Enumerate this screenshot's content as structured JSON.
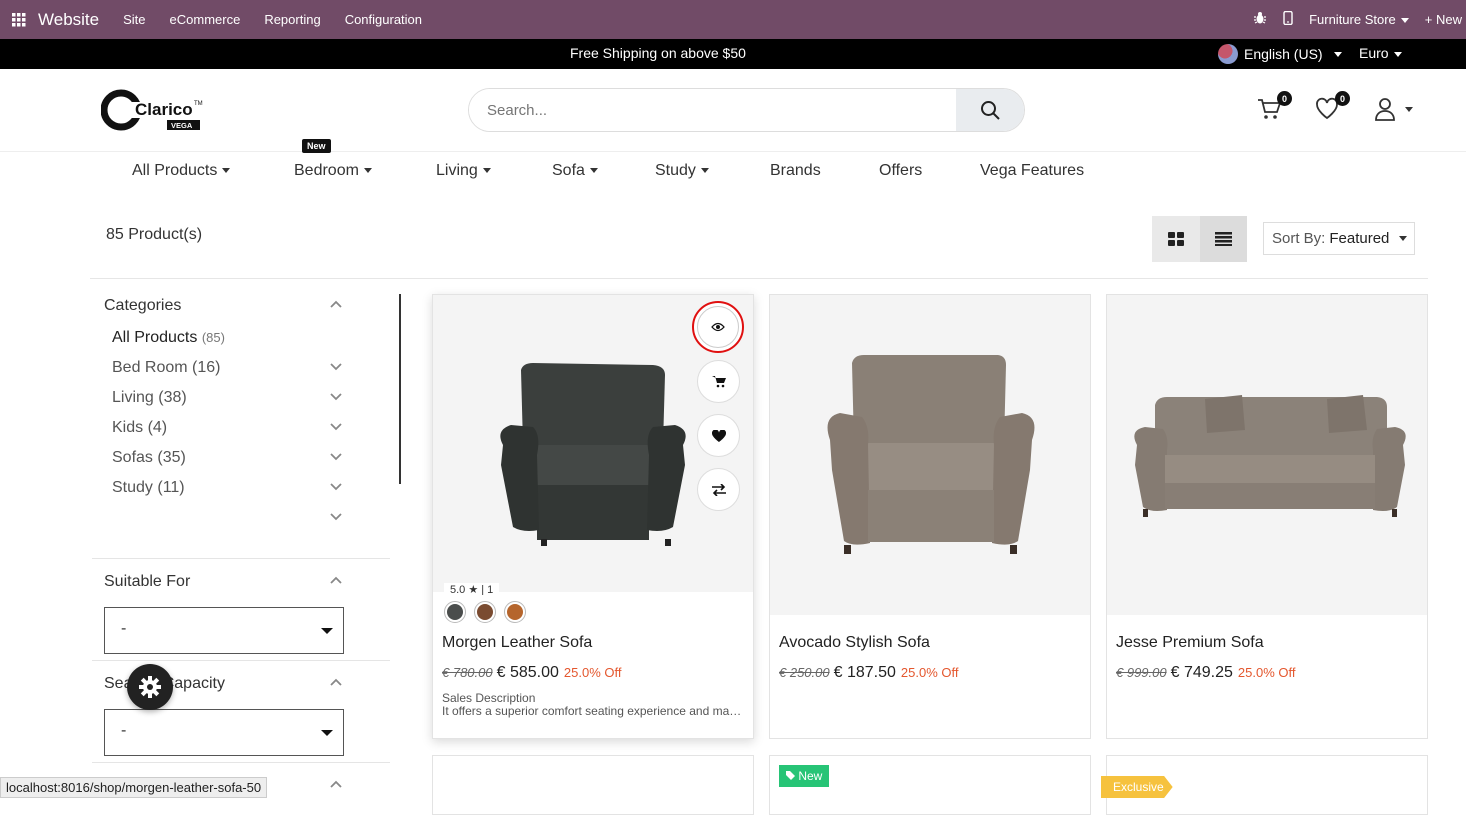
{
  "admin_bar": {
    "brand": "Website",
    "menu": [
      "Site",
      "eCommerce",
      "Reporting",
      "Configuration"
    ],
    "store": "Furniture Store",
    "new_label": "+ New"
  },
  "promo": {
    "message": "Free Shipping on above $50",
    "language": "English (US)",
    "currency": "Euro"
  },
  "header": {
    "logo_text": "Clarico",
    "logo_sub": "VEGA",
    "search_placeholder": "Search...",
    "cart_count": "0",
    "wishlist_count": "0"
  },
  "nav": {
    "items": [
      "All Products",
      "Bedroom",
      "Living",
      "Sofa",
      "Study",
      "Brands",
      "Offers",
      "Vega Features"
    ],
    "new_tag": "New"
  },
  "toolbar": {
    "count": "85 Product(s)",
    "sort_label": "Sort By:",
    "sort_value": "Featured"
  },
  "sidebar": {
    "categories_title": "Categories",
    "categories": [
      {
        "name": "All Products",
        "count": "(85)"
      },
      {
        "name": "Bed Room (16)",
        "count": ""
      },
      {
        "name": "Living (38)",
        "count": ""
      },
      {
        "name": "Kids (4)",
        "count": ""
      },
      {
        "name": "Sofas (35)",
        "count": ""
      },
      {
        "name": "Study (11)",
        "count": ""
      }
    ],
    "suitable_title": "Suitable For",
    "suitable_value": "-",
    "seating_title": "Seating Capacity",
    "seating_value": "-"
  },
  "products": [
    {
      "name": "Morgen Leather Sofa",
      "old_price": "€ 780.00",
      "price": "€ 585.00",
      "discount": "25.0% Off",
      "rating": "5.0 ★ | 1",
      "desc_title": "Sales Description",
      "desc": "It offers a superior comfort seating experience and makes a statement in any living room.",
      "swatches": [
        "#4a4d4c",
        "#7a4b30",
        "#b5652c"
      ]
    },
    {
      "name": "Avocado Stylish Sofa",
      "old_price": "€ 250.00",
      "price": "€ 187.50",
      "discount": "25.0% Off"
    },
    {
      "name": "Jesse Premium Sofa",
      "old_price": "€ 999.00",
      "price": "€ 749.25",
      "discount": "25.0% Off"
    }
  ],
  "ribbons": {
    "new": "New",
    "exclusive": "Exclusive"
  },
  "status_url": "localhost:8016/shop/morgen-leather-sofa-50",
  "colors": {
    "admin": "#714b67",
    "discount": "#e4572e",
    "new_ribbon": "#27c476",
    "exclusive_ribbon": "#f6c23e"
  }
}
